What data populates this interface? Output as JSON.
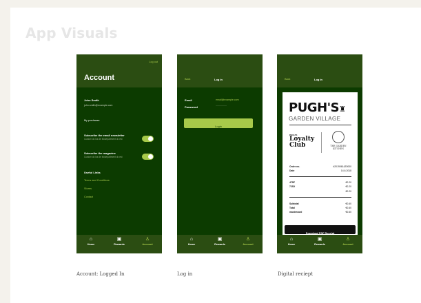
{
  "page": {
    "heading": "App Visuals"
  },
  "account": {
    "logout": "Log out",
    "title": "Account",
    "user_name": "John Smith",
    "user_email": "john.smith@example.com",
    "my_purchases": "My purchases",
    "newsletter_label": "Subscribe the email newsletter",
    "newsletter_sub": "Custom do los de biosepartment do est",
    "magazine_label": "Subscribe the magazine",
    "magazine_sub": "Custom do los de biosepartment do est",
    "useful_links_title": "Useful Links",
    "links": [
      "Terms and Conditions",
      "Stores",
      "Contact"
    ],
    "newsletter_on": true,
    "magazine_on": true
  },
  "login": {
    "back": "Back",
    "title": "Log in",
    "email_label": "Email",
    "email_value": "email@example.com",
    "password_label": "Password",
    "password_value": "................",
    "login_button": "Login"
  },
  "receipt": {
    "back": "Back",
    "title": "Log in",
    "brand": "PUGH'S",
    "brand_sub": "GARDEN VILLAGE",
    "loyalty_small": "PUGH'S",
    "loyalty_line1": "Loyalty",
    "loyalty_line2": "Club",
    "partner_line1": "THE GARDEN",
    "partner_line2": "KITCHEN",
    "rows": [
      {
        "k": "Order no.",
        "v": "#20190614Z0000"
      },
      {
        "k": "Date",
        "v": "14.6.2018"
      },
      {
        "k": "47SF",
        "v": "€0.20"
      },
      {
        "k": "72SX",
        "v": "€0.20"
      },
      {
        "k": "",
        "v": "€0.20"
      },
      {
        "k": "Subtotal",
        "v": "€0.60"
      },
      {
        "k": "Total",
        "v": "€0.60"
      },
      {
        "k": "mastercard",
        "v": "€0.60"
      }
    ],
    "download_button": "Download PDF Receipt"
  },
  "tabbar": [
    {
      "label": "Home",
      "icon": "home-icon"
    },
    {
      "label": "Rewards",
      "icon": "gift-icon"
    },
    {
      "label": "Account",
      "icon": "person-icon"
    }
  ],
  "captions": [
    "Account: Logged In",
    "Log in",
    "Digital reciept"
  ],
  "colors": {
    "dark_green": "#0c3b00",
    "header_green": "#2b4d12",
    "accent": "#a7c94a",
    "background": "#f4f2ec"
  }
}
